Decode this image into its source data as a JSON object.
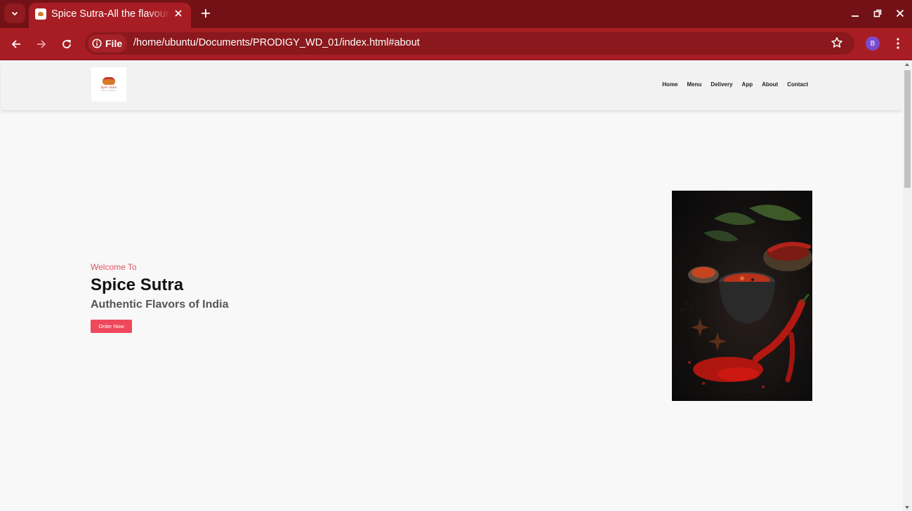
{
  "browser": {
    "tab": {
      "title": "Spice Sutra-All the flavours of India"
    },
    "address": {
      "chip_label": "File",
      "url": "/home/ubuntu/Documents/PRODIGY_WD_01/index.html#about"
    },
    "profile_initial": "B"
  },
  "page": {
    "logo": {
      "name": "Spice Sutra",
      "subtitle": "RESTAURANT"
    },
    "nav": [
      "Home",
      "Menu",
      "Delivery",
      "App",
      "About",
      "Contact"
    ],
    "hero": {
      "welcome": "Welcome To",
      "title": "Spice Sutra",
      "tagline": "Authentic Flavors of India",
      "button": "Order Now"
    }
  },
  "colors": {
    "accent": "#f0485b",
    "browser_frame": "#a81d24"
  }
}
